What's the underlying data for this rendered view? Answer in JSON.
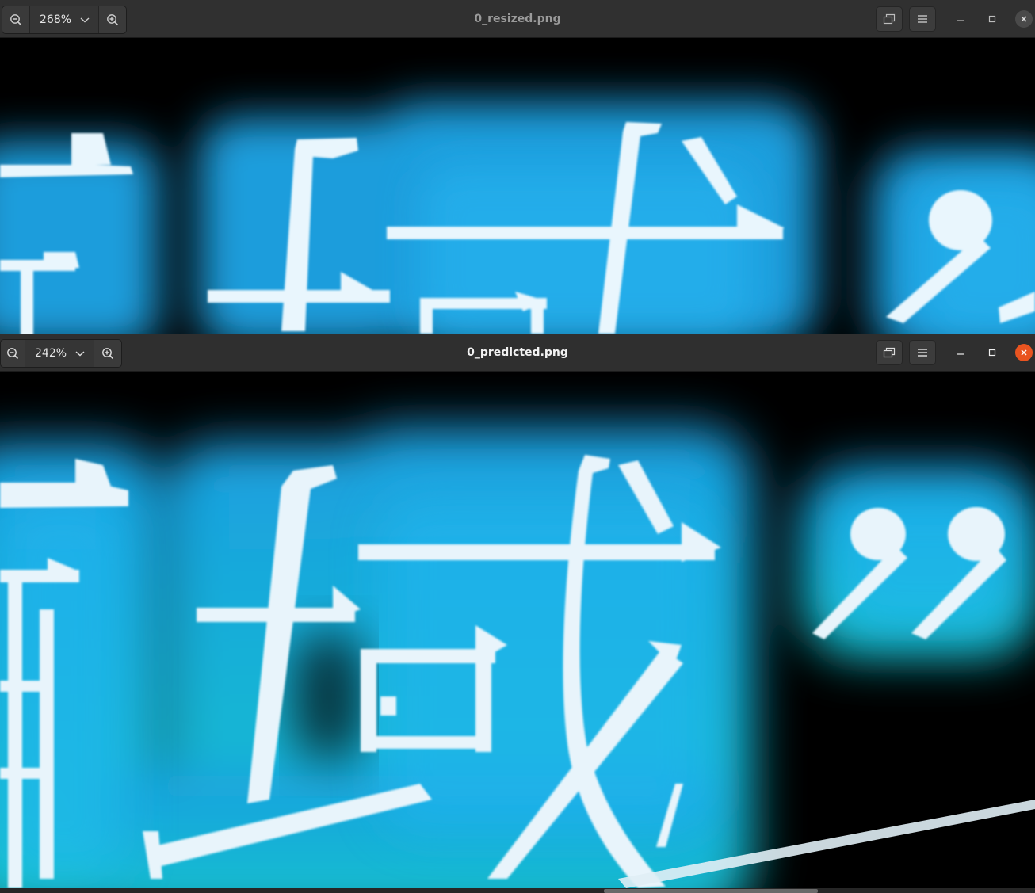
{
  "windows": [
    {
      "title": "0_resized.png",
      "zoom": "268%",
      "active": false
    },
    {
      "title": "0_predicted.png",
      "zoom": "242%",
      "active": true
    }
  ],
  "icons": {
    "zoom_out": "zoom-out-icon",
    "zoom_in": "zoom-in-icon",
    "dropdown": "chevron-down-icon",
    "view": "gallery-icon",
    "menu": "hamburger-menu-icon",
    "minimize": "minimize-icon",
    "maximize": "maximize-icon",
    "close": "close-icon"
  },
  "colors": {
    "glow": "#1aa6e6",
    "stroke": "#e8f4fb",
    "close_active": "#e95420"
  },
  "image_content": {
    "bottom_text": "域”"
  }
}
